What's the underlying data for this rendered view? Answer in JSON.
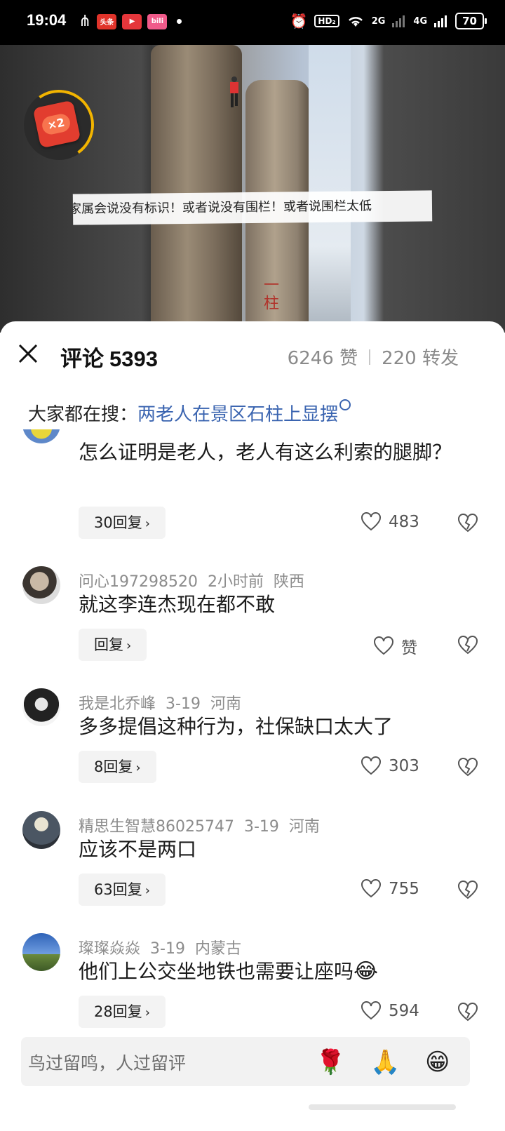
{
  "status_bar": {
    "time": "19:04",
    "app_badge_1": "头条",
    "app_badge_3": "bili",
    "hd_label": "HD₂",
    "net_2g": "2G",
    "net_4g": "4G",
    "battery": "70"
  },
  "video": {
    "caption": "家属会说没有标识！或者说没有围栏！或者说围栏太低",
    "reward_multiplier": "×2",
    "rock_text": "一柱"
  },
  "header": {
    "title": "评论",
    "comment_count": "5393",
    "likes": "6246 赞",
    "shares": "220 转发"
  },
  "hot_search": {
    "label": "大家都在搜：",
    "query": "两老人在景区石柱上显摆"
  },
  "comments": [
    {
      "text": "怎么证明是老人，老人有这么利索的腿脚？",
      "reply_label": "30回复",
      "likes": "483"
    },
    {
      "user": "问心197298520",
      "time": "2小时前",
      "location": "陕西",
      "text": "就这李连杰现在都不敢",
      "reply_label": "回复",
      "likes": "赞"
    },
    {
      "user": "我是北乔峰",
      "time": "3-19",
      "location": "河南",
      "text": "多多提倡这种行为，社保缺口太大了",
      "reply_label": "8回复",
      "likes": "303"
    },
    {
      "user": "精思生智慧86025747",
      "time": "3-19",
      "location": "河南",
      "text": "应该不是两口",
      "reply_label": "63回复",
      "likes": "755"
    },
    {
      "user": "璨璨焱焱",
      "time": "3-19",
      "location": "内蒙古",
      "text": "他们上公交坐地铁也需要让座吗",
      "reply_label": "28回复",
      "likes": "594"
    }
  ],
  "input_bar": {
    "placeholder": "鸟过留鸣，人过留评",
    "emoji_1": "🌹",
    "emoji_2": "🙏",
    "emoji_3": "😁"
  },
  "colors": {
    "link": "#3a64b0",
    "muted": "#8c8c8c",
    "reward_red": "#e23d2f",
    "reward_ring": "#f2b400"
  }
}
